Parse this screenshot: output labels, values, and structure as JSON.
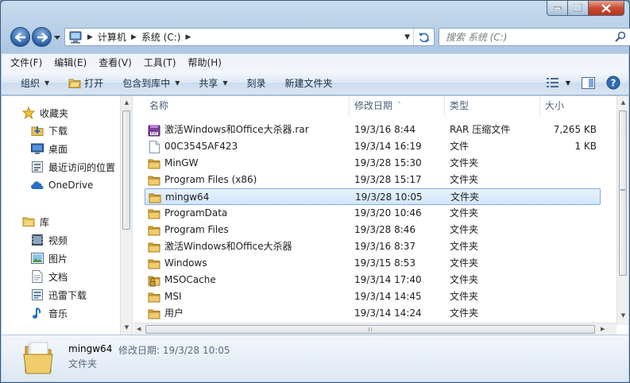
{
  "window": {
    "caption_buttons": [
      "minimize",
      "maximize",
      "close"
    ]
  },
  "address_bar": {
    "breadcrumbs": [
      "计算机",
      "系统 (C:)"
    ]
  },
  "search": {
    "placeholder": "搜索 系统 (C:)"
  },
  "menu": {
    "items": [
      "文件(F)",
      "编辑(E)",
      "查看(V)",
      "工具(T)",
      "帮助(H)"
    ]
  },
  "toolbar": {
    "organize": "组织",
    "open": "打开",
    "include_in_library": "包含到库中",
    "share": "共享",
    "burn": "刻录",
    "new_folder": "新建文件夹"
  },
  "sidebar": {
    "favorites_header": "收藏夹",
    "favorites": [
      "下载",
      "桌面",
      "最近访问的位置"
    ],
    "onedrive": "OneDrive",
    "libraries_header": "库",
    "libraries": [
      "视频",
      "图片",
      "文档",
      "迅雷下载",
      "音乐"
    ]
  },
  "columns": {
    "name": "名称",
    "date": "修改日期",
    "type": "类型",
    "size": "大小"
  },
  "files": [
    {
      "name": "激活Windows和Office大杀器.rar",
      "date": "19/3/16 8:44",
      "type": "RAR 压缩文件",
      "size": "7,265 KB",
      "icon": "rar-archive-icon"
    },
    {
      "name": "00C3545AF423",
      "date": "19/3/14 16:19",
      "type": "文件",
      "size": "1 KB",
      "icon": "blank-file-icon"
    },
    {
      "name": "MinGW",
      "date": "19/3/28 15:30",
      "type": "文件夹",
      "size": "",
      "icon": "folder-icon"
    },
    {
      "name": "Program Files (x86)",
      "date": "19/3/28 15:17",
      "type": "文件夹",
      "size": "",
      "icon": "folder-icon"
    },
    {
      "name": "mingw64",
      "date": "19/3/28 10:05",
      "type": "文件夹",
      "size": "",
      "icon": "folder-icon",
      "selected": true
    },
    {
      "name": "ProgramData",
      "date": "19/3/20 10:46",
      "type": "文件夹",
      "size": "",
      "icon": "folder-icon"
    },
    {
      "name": "Program Files",
      "date": "19/3/28 8:46",
      "type": "文件夹",
      "size": "",
      "icon": "folder-icon"
    },
    {
      "name": "激活Windows和Office大杀器",
      "date": "19/3/16 8:37",
      "type": "文件夹",
      "size": "",
      "icon": "folder-icon"
    },
    {
      "name": "Windows",
      "date": "19/3/15 8:53",
      "type": "文件夹",
      "size": "",
      "icon": "folder-icon"
    },
    {
      "name": "MSOCache",
      "date": "19/3/14 17:40",
      "type": "文件夹",
      "size": "",
      "icon": "locked-folder-icon"
    },
    {
      "name": "MSI",
      "date": "19/3/14 14:45",
      "type": "文件夹",
      "size": "",
      "icon": "folder-icon"
    },
    {
      "name": "用户",
      "date": "19/3/14 14:24",
      "type": "文件夹",
      "size": "",
      "icon": "folder-icon"
    }
  ],
  "details": {
    "name": "mingw64",
    "modified_label": "修改日期:",
    "modified_value": "19/3/28 10:05",
    "type": "文件夹"
  },
  "colors": {
    "selection": "#d1e5fb",
    "folder": "#e8c25a",
    "chrome": "#b9d0e8"
  }
}
